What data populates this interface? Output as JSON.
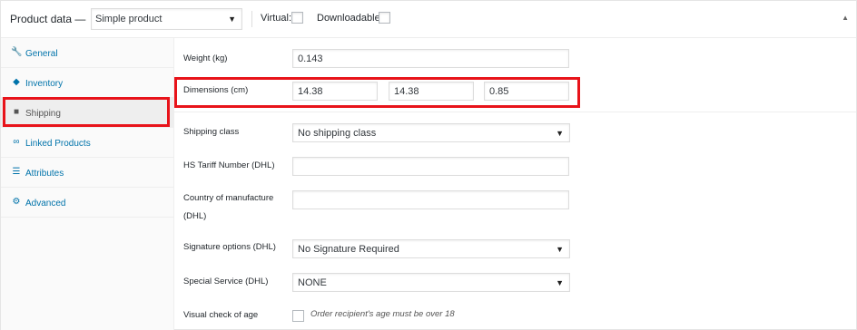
{
  "header": {
    "title": "Product data —",
    "product_type": "Simple product",
    "virtual_label": "Virtual:",
    "downloadable_label": "Downloadable:"
  },
  "sidebar": {
    "items": [
      {
        "label": "General",
        "icon": "wrench-icon"
      },
      {
        "label": "Inventory",
        "icon": "tag-icon"
      },
      {
        "label": "Shipping",
        "icon": "truck-icon",
        "active": true
      },
      {
        "label": "Linked Products",
        "icon": "link-icon"
      },
      {
        "label": "Attributes",
        "icon": "list-icon"
      },
      {
        "label": "Advanced",
        "icon": "gear-icon"
      }
    ]
  },
  "form": {
    "weight_label": "Weight (kg)",
    "weight_value": "0.143",
    "dimensions_label": "Dimensions (cm)",
    "length_value": "14.38",
    "width_value": "14.38",
    "height_value": "0.85",
    "shipping_class_label": "Shipping class",
    "shipping_class_value": "No shipping class",
    "hs_tariff_label": "HS Tariff Number (DHL)",
    "hs_tariff_value": "",
    "country_label_line1": "Country of manufacture",
    "country_label_line2": "(DHL)",
    "country_value": "",
    "signature_label": "Signature options (DHL)",
    "signature_value": "No Signature Required",
    "special_service_label": "Special Service (DHL)",
    "special_service_value": "NONE",
    "visual_check_label": "Visual check of age",
    "visual_check_desc": "Order recipient's age must be over 18"
  },
  "colors": {
    "link": "#0073aa",
    "highlight": "#e8131a"
  }
}
